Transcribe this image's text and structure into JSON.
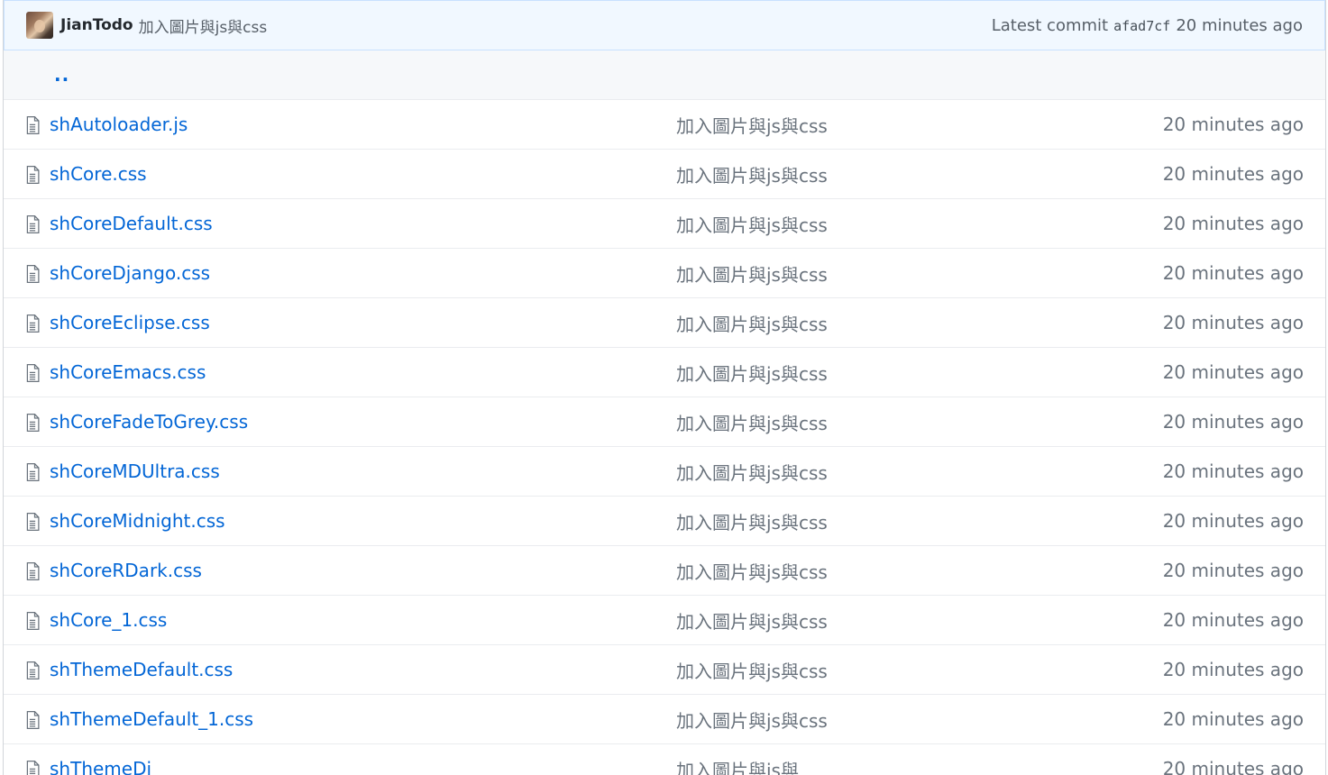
{
  "commit": {
    "avatar_icon": "user-avatar",
    "author": "JianTodo",
    "message": "加入圖片與js與css",
    "latest_label": "Latest commit",
    "sha": "afad7cf",
    "age": "20 minutes ago"
  },
  "parent_dir": {
    "label": ".."
  },
  "files": [
    {
      "icon": "file-icon",
      "name": "shAutoloader.js",
      "message": "加入圖片與js與css",
      "age": "20 minutes ago"
    },
    {
      "icon": "file-icon",
      "name": "shCore.css",
      "message": "加入圖片與js與css",
      "age": "20 minutes ago"
    },
    {
      "icon": "file-icon",
      "name": "shCoreDefault.css",
      "message": "加入圖片與js與css",
      "age": "20 minutes ago"
    },
    {
      "icon": "file-icon",
      "name": "shCoreDjango.css",
      "message": "加入圖片與js與css",
      "age": "20 minutes ago"
    },
    {
      "icon": "file-icon",
      "name": "shCoreEclipse.css",
      "message": "加入圖片與js與css",
      "age": "20 minutes ago"
    },
    {
      "icon": "file-icon",
      "name": "shCoreEmacs.css",
      "message": "加入圖片與js與css",
      "age": "20 minutes ago"
    },
    {
      "icon": "file-icon",
      "name": "shCoreFadeToGrey.css",
      "message": "加入圖片與js與css",
      "age": "20 minutes ago"
    },
    {
      "icon": "file-icon",
      "name": "shCoreMDUltra.css",
      "message": "加入圖片與js與css",
      "age": "20 minutes ago"
    },
    {
      "icon": "file-icon",
      "name": "shCoreMidnight.css",
      "message": "加入圖片與js與css",
      "age": "20 minutes ago"
    },
    {
      "icon": "file-icon",
      "name": "shCoreRDark.css",
      "message": "加入圖片與js與css",
      "age": "20 minutes ago"
    },
    {
      "icon": "file-icon",
      "name": "shCore_1.css",
      "message": "加入圖片與js與css",
      "age": "20 minutes ago"
    },
    {
      "icon": "file-icon",
      "name": "shThemeDefault.css",
      "message": "加入圖片與js與css",
      "age": "20 minutes ago"
    },
    {
      "icon": "file-icon",
      "name": "shThemeDefault_1.css",
      "message": "加入圖片與js與css",
      "age": "20 minutes ago"
    },
    {
      "icon": "file-icon",
      "name": "shThemeDj",
      "message": "加入圖片與js與",
      "age": "20 minutes ago"
    }
  ],
  "colors": {
    "link": "#0366d6",
    "muted": "#6a737d",
    "commit_bar_bg": "#f1f8ff",
    "commit_bar_border": "#c8e1ff",
    "row_border": "#eaecef",
    "parent_row_bg": "#f6f8fa"
  }
}
